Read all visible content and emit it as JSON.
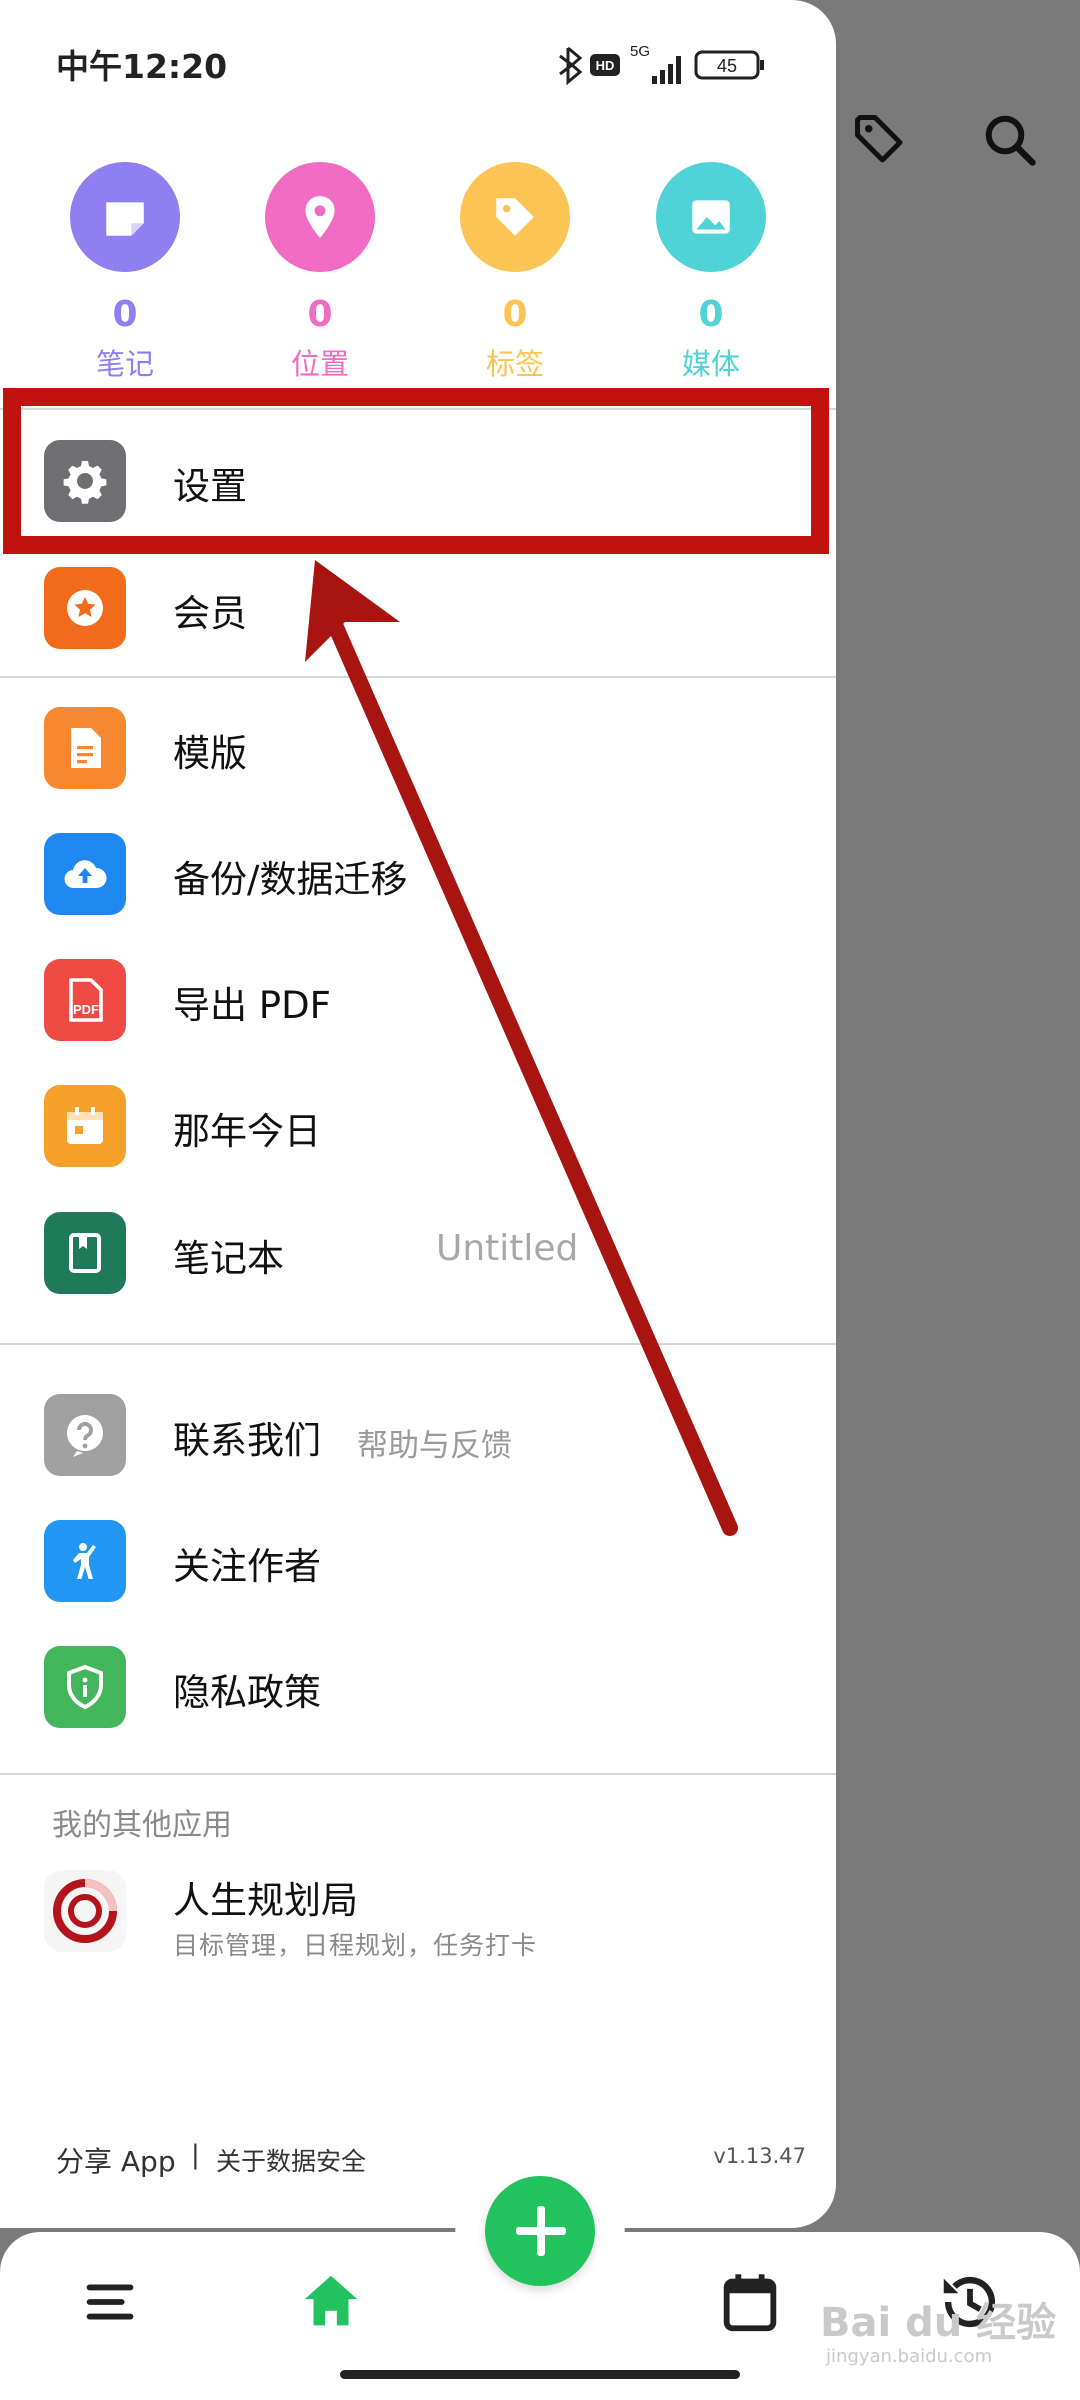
{
  "status_bar": {
    "time": "中午12:20",
    "network": "5G",
    "hd_badge": "HD",
    "battery": "45"
  },
  "stats": [
    {
      "count": "0",
      "label": "笔记",
      "icon": "note-icon",
      "color": "#8f7ff0"
    },
    {
      "count": "0",
      "label": "位置",
      "icon": "location-pin-icon",
      "color": "#f06cc3"
    },
    {
      "count": "0",
      "label": "标签",
      "icon": "tag-icon",
      "color": "#fbc455"
    },
    {
      "count": "0",
      "label": "媒体",
      "icon": "image-icon",
      "color": "#4fd3d6"
    }
  ],
  "menu": {
    "settings": "设置",
    "membership": "会员",
    "templates": "模版",
    "backup": "备份/数据迁移",
    "export_pdf": "导出 PDF",
    "on_this_day": "那年今日",
    "notebook": "笔记本",
    "notebook_value": "Untitled",
    "contact": "联系我们",
    "contact_hint": "帮助与反馈",
    "follow": "关注作者",
    "privacy": "隐私政策"
  },
  "other_apps": {
    "section_title": "我的其他应用",
    "app_name": "人生规划局",
    "app_desc": "目标管理，日程规划，任务打卡"
  },
  "footer": {
    "share": "分享 App",
    "separator": "|",
    "about": "关于数据安全",
    "version": "v1.13.47"
  },
  "watermark": {
    "text": "Bai du 经验",
    "url": "jingyan.baidu.com"
  },
  "colors": {
    "settings": "#6f6f73",
    "membership": "#f26a1b",
    "templates": "#f7882f",
    "backup": "#1e88f0",
    "pdf": "#f04a44",
    "calendar": "#f5a028",
    "notebook": "#1f7a5a",
    "contact": "#a0a0a0",
    "follow": "#2196f3",
    "privacy": "#43b55a",
    "fab": "#22c35e",
    "annotation": "#c0130f"
  }
}
